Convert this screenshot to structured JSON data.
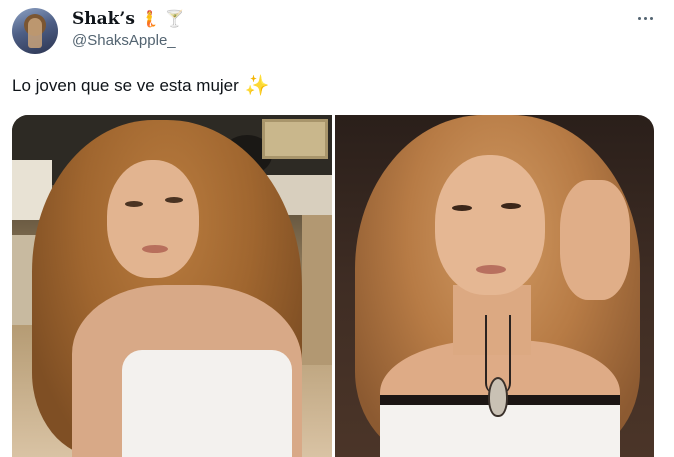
{
  "author": {
    "display_name": "Shak’s",
    "display_emojis": [
      "mermaid-icon",
      "cocktail-icon"
    ],
    "handle": "@ShaksApple_",
    "avatar": "profile-avatar"
  },
  "menu": {
    "icon": "more-dots-icon"
  },
  "tweet": {
    "text": "Lo joven que se ve esta mujer",
    "trailing_emoji": "sparkles-icon"
  },
  "media": {
    "photo_count": 2,
    "photos": [
      "woman-long-curly-hair-studio",
      "woman-long-wavy-hair-pendant-necklace"
    ]
  },
  "colors": {
    "text_primary": "#0f1419",
    "text_secondary": "#536471",
    "sparkles": "#f5b913",
    "background": "#ffffff"
  }
}
